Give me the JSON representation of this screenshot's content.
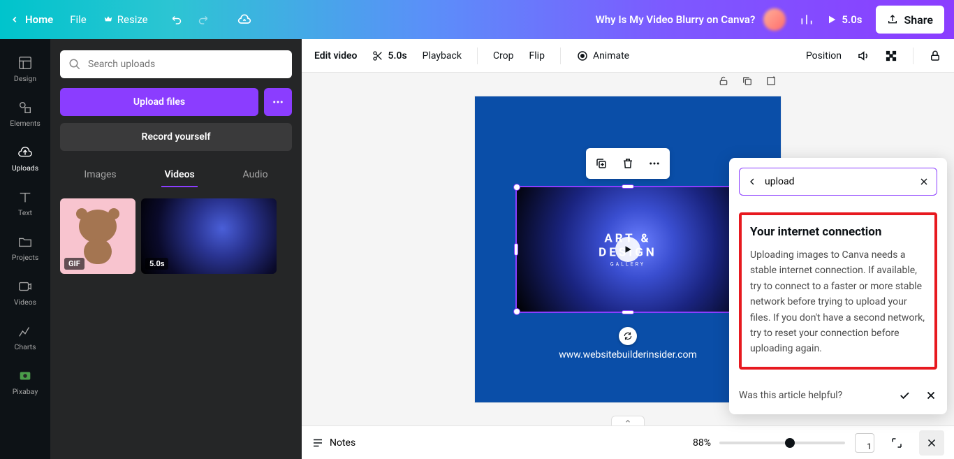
{
  "topbar": {
    "home": "Home",
    "file": "File",
    "resize": "Resize",
    "title": "Why Is My Video Blurry on Canva?",
    "duration": "5.0s",
    "share": "Share"
  },
  "rail": {
    "items": [
      {
        "id": "design",
        "label": "Design"
      },
      {
        "id": "elements",
        "label": "Elements"
      },
      {
        "id": "uploads",
        "label": "Uploads"
      },
      {
        "id": "text",
        "label": "Text"
      },
      {
        "id": "projects",
        "label": "Projects"
      },
      {
        "id": "videos",
        "label": "Videos"
      },
      {
        "id": "charts",
        "label": "Charts"
      },
      {
        "id": "pixabay",
        "label": "Pixabay"
      }
    ]
  },
  "panel": {
    "search_placeholder": "Search uploads",
    "upload": "Upload files",
    "record": "Record yourself",
    "tabs": {
      "images": "Images",
      "videos": "Videos",
      "audio": "Audio"
    },
    "thumb1_badge": "GIF",
    "thumb2_badge": "5.0s"
  },
  "toolbar": {
    "edit_video": "Edit video",
    "duration": "5.0s",
    "playback": "Playback",
    "crop": "Crop",
    "flip": "Flip",
    "animate": "Animate",
    "position": "Position"
  },
  "canvas": {
    "art_line1": "ART & DESIGN",
    "art_line2": "GALLERY",
    "url": "www.websitebuilderinsider.com"
  },
  "help": {
    "search_value": "upload",
    "heading": "Your internet connection",
    "body": "Uploading images to Canva needs a stable internet connection. If available, try to connect to a faster or more stable network before trying to upload your files. If you don't have a second network, try to reset your connection before uploading again.",
    "footer": "Was this article helpful?"
  },
  "bottombar": {
    "notes": "Notes",
    "zoom": "88%",
    "page": "1"
  }
}
